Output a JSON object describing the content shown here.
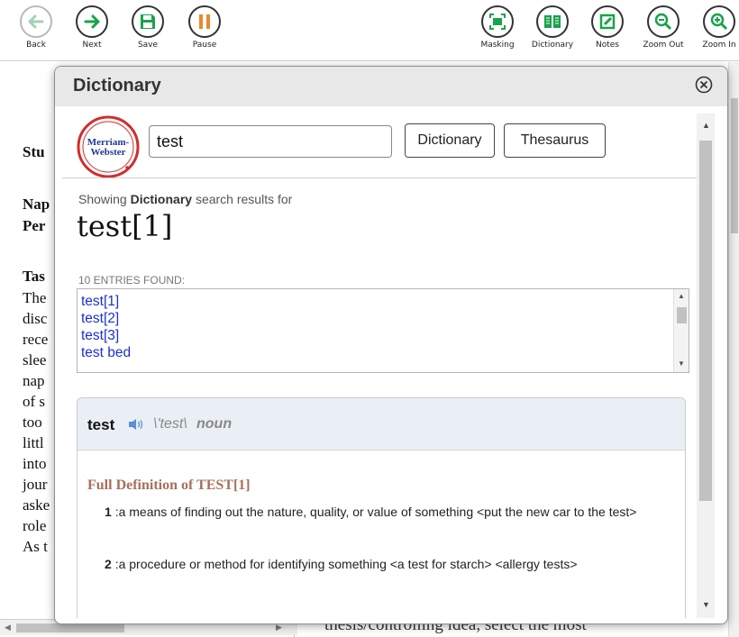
{
  "toolbar": {
    "left": [
      {
        "label": "Back",
        "icon": "arrow-left-icon"
      },
      {
        "label": "Next",
        "icon": "arrow-right-icon"
      },
      {
        "label": "Save",
        "icon": "save-icon"
      },
      {
        "label": "Pause",
        "icon": "pause-icon"
      }
    ],
    "right": [
      {
        "label": "Masking",
        "icon": "masking-icon"
      },
      {
        "label": "Dictionary",
        "icon": "book-icon"
      },
      {
        "label": "Notes",
        "icon": "notes-icon"
      },
      {
        "label": "Zoom Out",
        "icon": "zoom-out-icon"
      },
      {
        "label": "Zoom In",
        "icon": "zoom-in-icon"
      }
    ]
  },
  "document": {
    "lines": [
      "Stu",
      "Nap",
      "Per",
      "Tas",
      "The",
      "disc",
      "rece",
      "slee",
      "nap",
      "of s",
      "too",
      "littl",
      "into",
      "jour",
      "aske",
      "role",
      "As t"
    ],
    "bottom_text": "thesis/controlling idea, select the most"
  },
  "dictionary": {
    "title": "Dictionary",
    "logo_text_1": "Merriam-",
    "logo_text_2": "Webster",
    "search_value": "test",
    "dictionary_button": "Dictionary",
    "thesaurus_button": "Thesaurus",
    "showing_prefix": "Showing ",
    "showing_bold": "Dictionary",
    "showing_suffix": " search results for",
    "headword": "test[1]",
    "entries_label": "10 ENTRIES FOUND:",
    "entries": [
      "test[1]",
      "test[2]",
      "test[3]",
      "test bed"
    ],
    "entry_word": "test",
    "pronunciation": "\\'test\\",
    "part_of_speech": "noun",
    "full_definition_label": "Full Definition of TEST[1]",
    "senses": [
      {
        "num": "1",
        "text": ":a means of finding out the nature, quality, or value of something <put the new car to the test>"
      },
      {
        "num": "2",
        "text": ":a procedure or method for identifying something <a test for starch> <allergy tests>"
      }
    ]
  },
  "colors": {
    "link": "#1b2fd8",
    "full_def_label": "#a86f5b",
    "icon_green": "#19a34a",
    "icon_orange": "#e8892a"
  }
}
